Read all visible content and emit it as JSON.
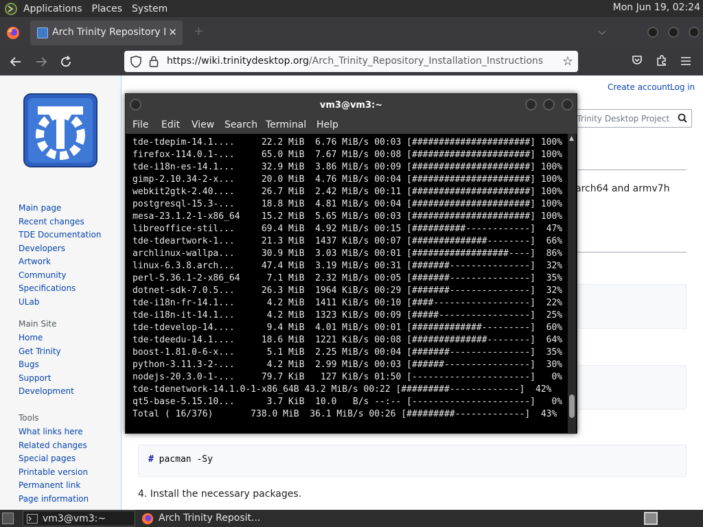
{
  "top_panel": {
    "menus": [
      "Applications",
      "Places",
      "System"
    ],
    "clock": "Mon Jun 19, 02:24"
  },
  "browser": {
    "tab_title": "Arch Trinity Repository Insta",
    "tab_close": "✕",
    "new_tab": "+",
    "url_host": "https://wiki.trinitydesktop.org",
    "url_path": "/Arch_Trinity_Repository_Installation_Instructions"
  },
  "wiki": {
    "top_links": {
      "create_account": "Create account",
      "log_in": "Log in"
    },
    "search_placeholder": "h Trinity Desktop Project",
    "nav_links": [
      "Main page",
      "Recent changes",
      "TDE Documentation",
      "Developers",
      "Artwork",
      "Community",
      "Specifications",
      "ULab"
    ],
    "main_site_heading": "Main Site",
    "main_site_links": [
      "Home",
      "Get Trinity",
      "Bugs",
      "Support",
      "Development"
    ],
    "tools_heading": "Tools",
    "tools_links": [
      "What links here",
      "Related changes",
      "Special pages",
      "Printable version",
      "Permanent link",
      "Page information"
    ],
    "body_fragment": "arch64 and armv7h",
    "code_prompt": "#",
    "code_command": " pacman -Sy",
    "step4": "4. Install the necessary packages."
  },
  "terminal": {
    "title": "vm3@vm3:~",
    "menu": [
      "File",
      "Edit",
      "View",
      "Search",
      "Terminal",
      "Help"
    ],
    "lines": [
      "tde-tdepim-14.1....     22.2 MiB  6.76 MiB/s 00:03 [######################] 100%",
      "firefox-114.0.1-...     65.0 MiB  7.67 MiB/s 00:08 [######################] 100%",
      "tde-i18n-es-14.1...     32.9 MiB  3.86 MiB/s 00:09 [######################] 100%",
      "gimp-2.10.34-2-x...     20.0 MiB  4.76 MiB/s 00:04 [######################] 100%",
      "webkit2gtk-2.40....     26.7 MiB  2.42 MiB/s 00:11 [######################] 100%",
      "postgresql-15.3-...     18.8 MiB  4.81 MiB/s 00:04 [######################] 100%",
      "mesa-23.1.2-1-x86_64    15.2 MiB  5.65 MiB/s 00:03 [######################] 100%",
      "libreoffice-stil...     69.4 MiB  4.92 MiB/s 00:15 [##########------------]  47%",
      "tde-tdeartwork-1...     21.3 MiB  1437 KiB/s 00:07 [##############--------]  66%",
      "archlinux-wallpa...     30.9 MiB  3.03 MiB/s 00:01 [##################----]  86%",
      "linux-6.3.8.arch...     47.4 MiB  3.19 MiB/s 00:31 [#######---------------]  32%",
      "perl-5.36.1-2-x86_64     7.1 MiB  2.32 MiB/s 00:05 [#######---------------]  35%",
      "dotnet-sdk-7.0.5...     26.3 MiB  1964 KiB/s 00:29 [#######---------------]  32%",
      "tde-i18n-fr-14.1...      4.2 MiB  1411 KiB/s 00:10 [####------------------]  22%",
      "tde-i18n-it-14.1...      4.2 MiB  1323 KiB/s 00:09 [#####-----------------]  25%",
      "tde-tdevelop-14....      9.4 MiB  4.01 MiB/s 00:01 [#############---------]  60%",
      "tde-tdeedu-14.1....     18.6 MiB  1221 KiB/s 00:08 [##############--------]  64%",
      "boost-1.81.0-6-x...      5.1 MiB  2.25 MiB/s 00:04 [#######---------------]  35%",
      "python-3.11.3-2-...      4.2 MiB  2.99 MiB/s 00:03 [######----------------]  30%",
      "nodejs-20.3.0-1-...     79.7 KiB   127 KiB/s 01:50 [----------------------]   0%",
      "tde-tdenetwork-14.1.0-1-x86_64B 43.2 MiB/s 00:22 [#########-------------]  42%",
      "qt5-base-5.15.10...      3.7 KiB  10.0   B/s --:-- [----------------------]   0%",
      "Total ( 16/376)       738.0 MiB  36.1 MiB/s 00:26 [#########-------------]  43%"
    ]
  },
  "taskbar": {
    "tasks": [
      "vm3@vm3:~",
      "Arch Trinity Reposit..."
    ]
  },
  "colors": {
    "link": "#0645ad",
    "terminal_bg": "#000000",
    "panel_bg": "#2d2d2d"
  }
}
